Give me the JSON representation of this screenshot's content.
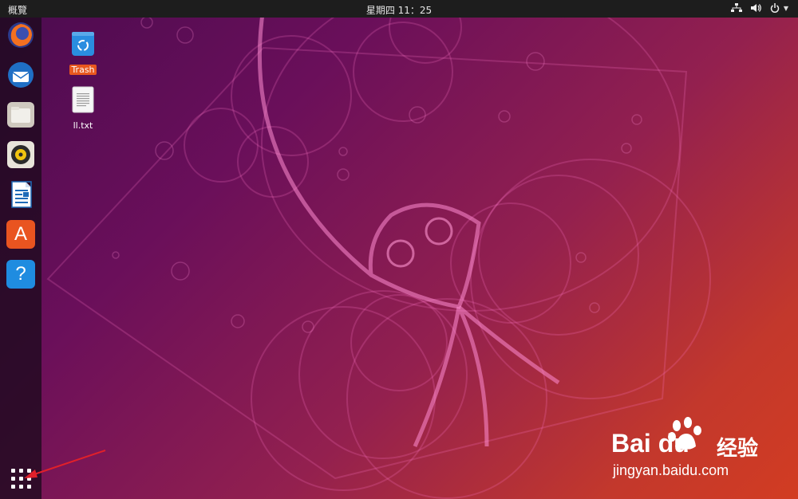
{
  "topbar": {
    "activities_label": "概覽",
    "clock_text": "星期四 11：25",
    "tray_icons": [
      "network-icon",
      "volume-icon",
      "power-icon"
    ]
  },
  "dock": {
    "apps": [
      {
        "name": "firefox-icon"
      },
      {
        "name": "thunderbird-icon"
      },
      {
        "name": "files-icon"
      },
      {
        "name": "rhythmbox-icon"
      },
      {
        "name": "libreoffice-writer-icon"
      },
      {
        "name": "software-center-icon",
        "glyph": "A"
      },
      {
        "name": "help-icon",
        "glyph": "?"
      }
    ],
    "show_apps": "show-applications-grid-icon"
  },
  "desktop": {
    "icons": [
      {
        "label": "Trash",
        "selected": true
      },
      {
        "label": "ll.txt",
        "selected": false
      }
    ]
  },
  "watermark": {
    "brand": "Bai du",
    "cn_text": "经验",
    "url": "jingyan.baidu.com"
  },
  "colors": {
    "topbar_bg": "#1d1d1d",
    "selection": "#e9581f",
    "annotation_arrow": "#e0202a"
  }
}
